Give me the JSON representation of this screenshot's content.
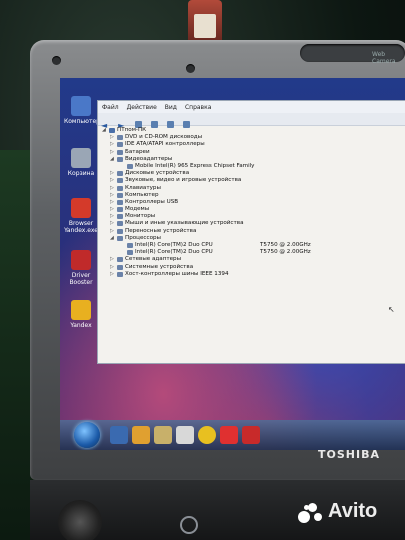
{
  "desktop_icons": [
    {
      "label": "Компьютер",
      "color": "#4a78c8"
    },
    {
      "label": "Корзина",
      "color": "#9aa6b5"
    },
    {
      "label": "Browser Yandex.exe",
      "color": "#d43a2a"
    },
    {
      "label": "Driver Booster",
      "color": "#c02a2a"
    },
    {
      "label": "Yandex",
      "color": "#e8b020"
    }
  ],
  "window": {
    "menu": [
      "Файл",
      "Действие",
      "Вид",
      "Справка"
    ],
    "root": "ПТпом-ПК",
    "devices": [
      {
        "label": "DVD и CD-ROM дисководы",
        "level": 1,
        "expanded": false
      },
      {
        "label": "IDE ATA/ATAPI контроллеры",
        "level": 1,
        "expanded": false
      },
      {
        "label": "Батареи",
        "level": 1,
        "expanded": false
      },
      {
        "label": "Видеоадаптеры",
        "level": 1,
        "expanded": true
      },
      {
        "label": "Mobile Intel(R) 965 Express Chipset Family",
        "level": 2
      },
      {
        "label": "Дисковые устройства",
        "level": 1,
        "expanded": false
      },
      {
        "label": "Звуковые, видео и игровые устройства",
        "level": 1,
        "expanded": false
      },
      {
        "label": "Клавиатуры",
        "level": 1,
        "expanded": false
      },
      {
        "label": "Компьютер",
        "level": 1,
        "expanded": false
      },
      {
        "label": "Контроллеры USB",
        "level": 1,
        "expanded": false
      },
      {
        "label": "Модемы",
        "level": 1,
        "expanded": false
      },
      {
        "label": "Мониторы",
        "level": 1,
        "expanded": false
      },
      {
        "label": "Мыши и иные указывающие устройства",
        "level": 1,
        "expanded": false
      },
      {
        "label": "Переносные устройства",
        "level": 1,
        "expanded": false
      },
      {
        "label": "Процессоры",
        "level": 1,
        "expanded": true
      },
      {
        "label": "Intel(R) Core(TM)2 Duo CPU",
        "level": 2,
        "model": "T5750 @ 2.00GHz"
      },
      {
        "label": "Intel(R) Core(TM)2 Duo CPU",
        "level": 2,
        "model": "T5750 @ 2.00GHz"
      },
      {
        "label": "Сетевые адаптеры",
        "level": 1,
        "expanded": false
      },
      {
        "label": "Системные устройства",
        "level": 1,
        "expanded": false
      },
      {
        "label": "Хост-контроллеры шины IEEE 1394",
        "level": 1,
        "expanded": false
      }
    ]
  },
  "laptop": {
    "brand": "TOSHIBA",
    "camera_label": "Web Camera"
  },
  "watermark": "Avito"
}
